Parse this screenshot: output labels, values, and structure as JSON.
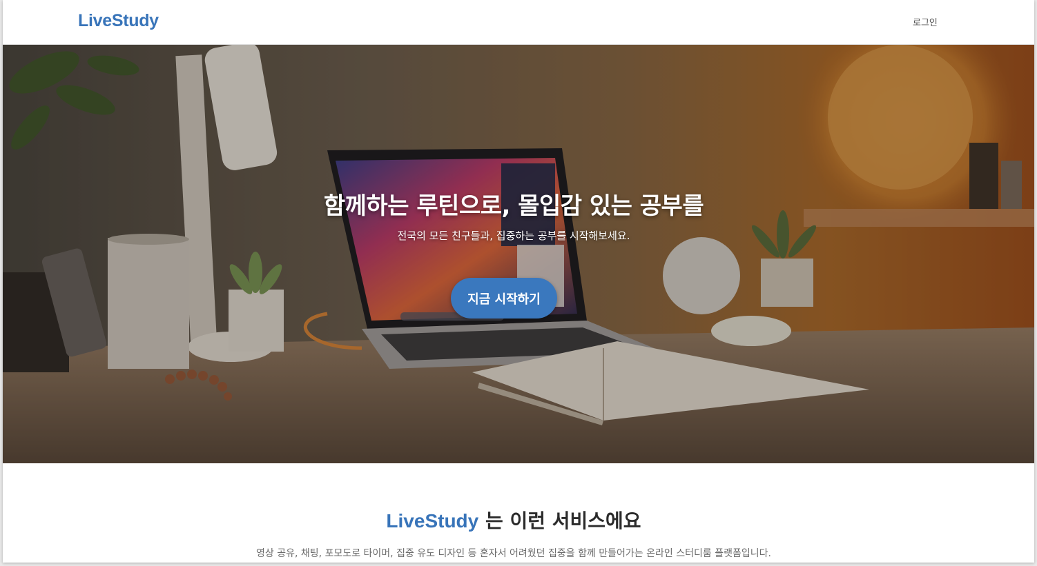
{
  "header": {
    "logo": "LiveStudy",
    "login_label": "로그인"
  },
  "hero": {
    "title": "함께하는 루틴으로, 몰입감 있는 공부를",
    "subtitle": "전국의 모든 친구들과, 집중하는 공부를 시작해보세요.",
    "cta_label": "지금 시작하기",
    "image": "desk-workspace-photo"
  },
  "intro": {
    "brand": "LiveStudy",
    "title_suffix": " 는 이런 서비스에요",
    "description": "영상 공유, 채팅, 포모도로 타이머, 집중 유도 디자인 등 혼자서 어려웠던 집중을 함께 만들어가는 온라인 스터디룸 플랫폼입니다."
  },
  "colors": {
    "brand": "#3874b9",
    "cta": "#3a78be",
    "text_dark": "#2b2b2b",
    "text_muted": "#6b6b6b"
  }
}
